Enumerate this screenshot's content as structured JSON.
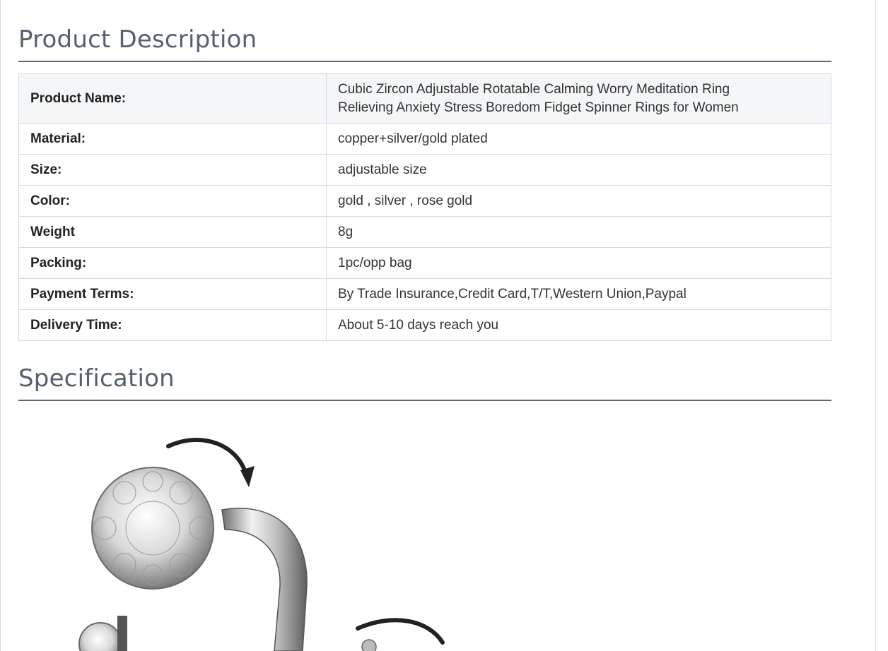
{
  "product_description": {
    "title": "Product Description",
    "rows": [
      {
        "label": "Product Name:",
        "value_line1": "Cubic Zircon Adjustable Rotatable Calming Worry Meditation Ring",
        "value_line2": "Relieving Anxiety Stress Boredom Fidget Spinner Rings for Women"
      },
      {
        "label": "Material:",
        "value": "copper+silver/gold plated"
      },
      {
        "label": "Size:",
        "value": "adjustable size"
      },
      {
        "label": "Color:",
        "value": "gold ,  silver ,  rose gold"
      },
      {
        "label": "Weight",
        "value": "8g"
      },
      {
        "label": "Packing:",
        "value": "1pc/opp bag"
      },
      {
        "label": "Payment Terms:",
        "value": "By Trade Insurance,Credit Card,T/T,Western Union,Paypal"
      },
      {
        "label": "Delivery Time:",
        "value": "About 5-10 days reach you"
      }
    ]
  },
  "specification": {
    "title": "Specification"
  },
  "colors": {
    "title_text": "#556170",
    "rule": "#5c6878",
    "header_row_bg": "#f4f6f8",
    "border": "#d6d9de"
  }
}
